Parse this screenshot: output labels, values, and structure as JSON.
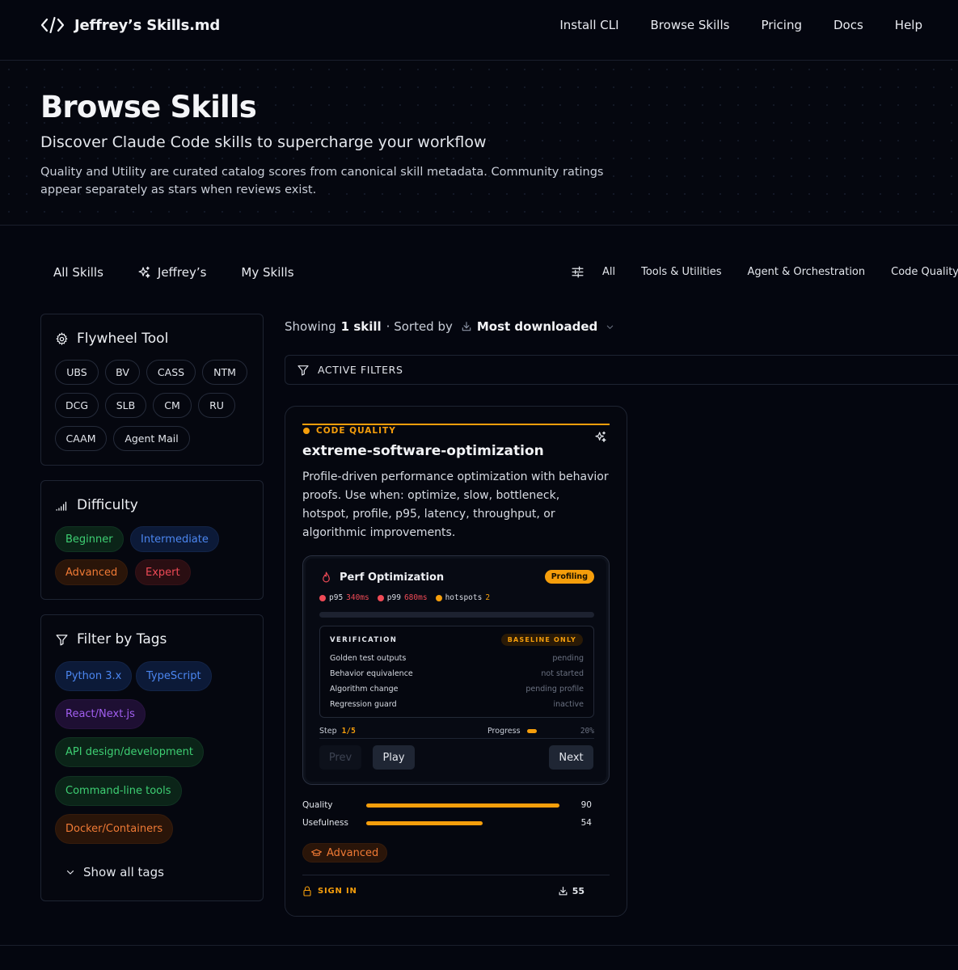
{
  "header": {
    "brand": "Jeffrey’s Skills.md",
    "nav": [
      "Install CLI",
      "Browse Skills",
      "Pricing",
      "Docs",
      "Help"
    ]
  },
  "hero": {
    "title": "Browse Skills",
    "subtitle": "Discover Claude Code skills to supercharge your workflow",
    "description": "Quality and Utility are curated catalog scores from canonical skill metadata. Community ratings appear separately as stars when reviews exist."
  },
  "tabs": [
    "All Skills",
    "Jeffrey’s",
    "My Skills"
  ],
  "categories": [
    "All",
    "Tools & Utilities",
    "Agent & Orchestration",
    "Code Quality"
  ],
  "sidebar": {
    "flywheel": {
      "title": "Flywheel Tool",
      "tools": [
        "UBS",
        "BV",
        "CASS",
        "NTM",
        "DCG",
        "SLB",
        "CM",
        "RU",
        "CAAM",
        "Agent Mail"
      ]
    },
    "difficulty": {
      "title": "Difficulty",
      "levels": [
        "Beginner",
        "Intermediate",
        "Advanced",
        "Expert"
      ]
    },
    "tags": {
      "title": "Filter by Tags",
      "items": [
        "Python 3.x",
        "TypeScript",
        "React/Next.js",
        "API design/development",
        "Command-line tools",
        "Docker/Containers"
      ],
      "show_all": "Show all tags"
    }
  },
  "results": {
    "showing_prefix": "Showing",
    "count_label": "1 skill",
    "sorted_by": "· Sorted by",
    "sort_value": "Most downloaded",
    "active_filters": "ACTIVE FILTERS"
  },
  "card": {
    "category": "CODE QUALITY",
    "title": "extreme-software-optimization",
    "description": "Profile-driven performance optimization with behavior proofs. Use when: optimize, slow, bottleneck, hotspot, profile, p95, latency, throughput, or algorithmic improvements.",
    "demo": {
      "title": "Perf Optimization",
      "badge": "Profiling",
      "metrics": [
        {
          "label": "p95",
          "value": "340ms",
          "color": "#ef4a56"
        },
        {
          "label": "p99",
          "value": "680ms",
          "color": "#ef4a56"
        },
        {
          "label": "hotspots",
          "value": "2",
          "color": "#f59e0b"
        }
      ],
      "verification_title": "VERIFICATION",
      "verification_badge": "BASELINE ONLY",
      "checks": [
        {
          "name": "Golden test outputs",
          "status": "pending"
        },
        {
          "name": "Behavior equivalence",
          "status": "not started"
        },
        {
          "name": "Algorithm change",
          "status": "pending profile"
        },
        {
          "name": "Regression guard",
          "status": "inactive"
        }
      ],
      "step_label": "Step",
      "step_value": "1/5",
      "progress_label": "Progress",
      "progress_text": "20%",
      "progress": 0.2,
      "buttons": {
        "prev": "Prev",
        "play": "Play",
        "next": "Next"
      }
    },
    "scores": [
      {
        "label": "Quality",
        "value": 90
      },
      {
        "label": "Usefulness",
        "value": 54
      }
    ],
    "level": "Advanced",
    "sign_in": "SIGN IN",
    "downloads": "55"
  },
  "colors": {
    "accent": "#f59e0b",
    "background": "#04060f"
  }
}
